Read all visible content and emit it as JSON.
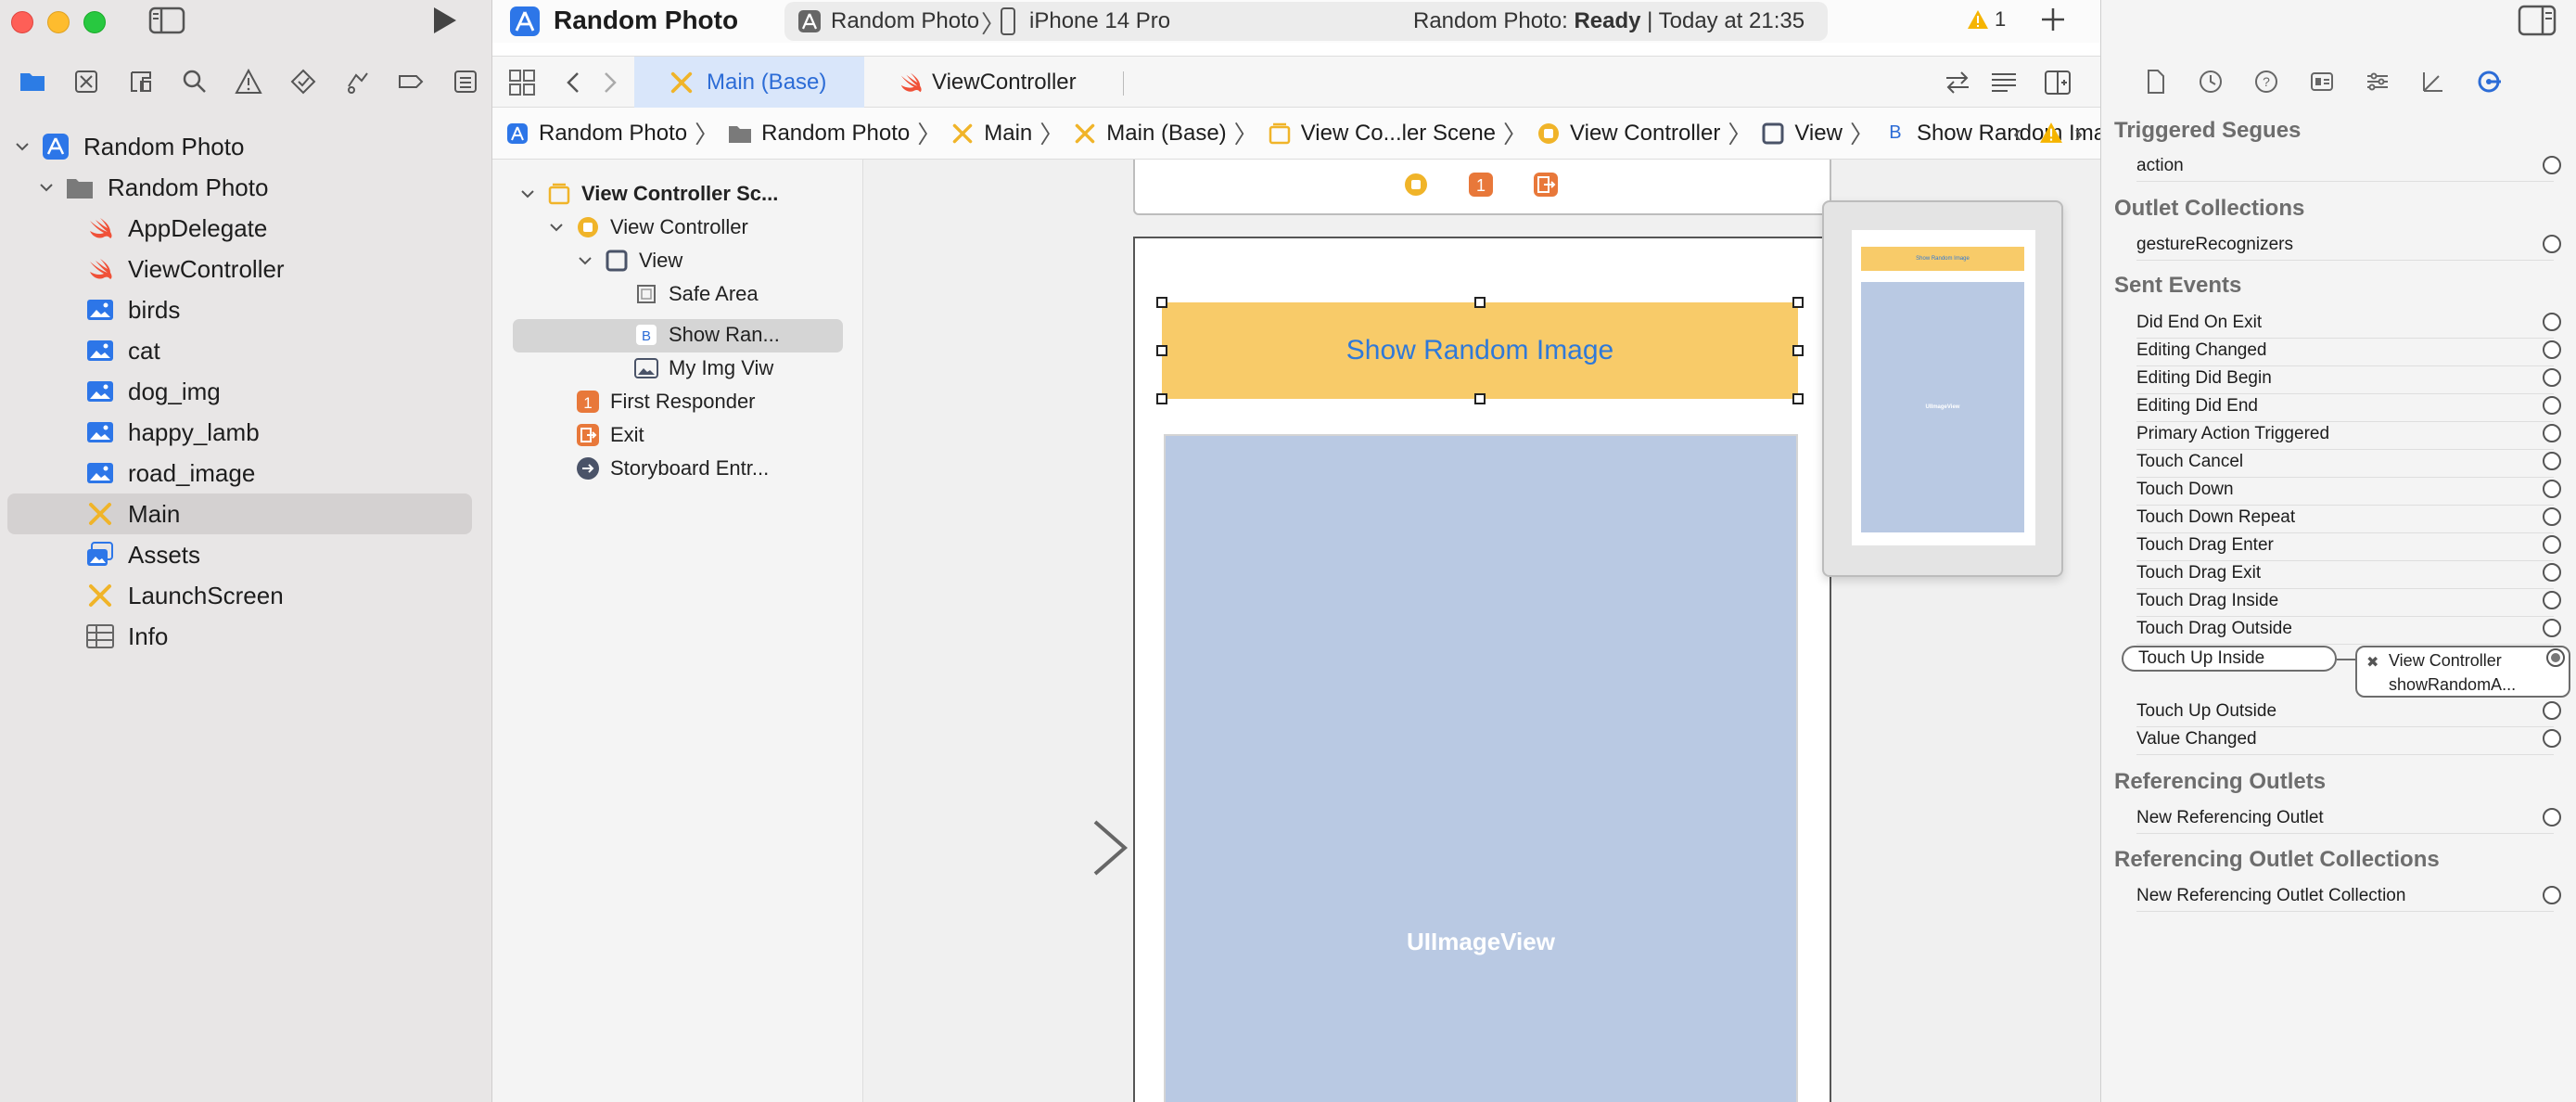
{
  "colors": {
    "accent": "#2c6cd6",
    "swift_orange": "#f05138",
    "storyboard_yellow": "#f0b429",
    "button_fill": "#f8cb69",
    "imageview_fill": "#b9c9e3"
  },
  "navigator": {
    "tabs": [
      "folder-icon",
      "source-control-icon",
      "symbol-icon",
      "find-icon",
      "issue-icon",
      "test-icon",
      "debug-icon",
      "breakpoint-icon",
      "report-icon"
    ],
    "items": [
      {
        "label": "Random Photo",
        "icon": "project-icon",
        "depth": 0,
        "expanded": true
      },
      {
        "label": "Random Photo",
        "icon": "folder-icon",
        "depth": 1,
        "expanded": true
      },
      {
        "label": "AppDelegate",
        "icon": "swift-icon",
        "depth": 2
      },
      {
        "label": "ViewController",
        "icon": "swift-icon",
        "depth": 2
      },
      {
        "label": "birds",
        "icon": "image-icon",
        "depth": 2
      },
      {
        "label": "cat",
        "icon": "image-icon",
        "depth": 2
      },
      {
        "label": "dog_img",
        "icon": "image-icon",
        "depth": 2
      },
      {
        "label": "happy_lamb",
        "icon": "image-icon",
        "depth": 2
      },
      {
        "label": "road_image",
        "icon": "image-icon",
        "depth": 2
      },
      {
        "label": "Main",
        "icon": "storyboard-icon",
        "depth": 2,
        "selected": true
      },
      {
        "label": "Assets",
        "icon": "assets-icon",
        "depth": 2
      },
      {
        "label": "LaunchScreen",
        "icon": "storyboard-icon",
        "depth": 2
      },
      {
        "label": "Info",
        "icon": "plist-icon",
        "depth": 2
      }
    ]
  },
  "toolbar": {
    "project_title": "Random Photo",
    "scheme": "Random Photo",
    "device": "iPhone 14 Pro",
    "status_prefix": "Random Photo: ",
    "status_state": "Ready",
    "status_suffix": " | Today at 21:35",
    "warning_count": "1"
  },
  "tabs": [
    {
      "label": "Main (Base)",
      "active": true,
      "icon": "storyboard-icon"
    },
    {
      "label": "ViewController",
      "active": false,
      "icon": "swift-icon"
    }
  ],
  "jumpbar": [
    {
      "label": "Random Photo",
      "icon": "project-icon"
    },
    {
      "label": "Random Photo",
      "icon": "folder-icon"
    },
    {
      "label": "Main",
      "icon": "storyboard-icon"
    },
    {
      "label": "Main (Base)",
      "icon": "storyboard-icon"
    },
    {
      "label": "View Co...ler Scene",
      "icon": "scene-icon"
    },
    {
      "label": "View Controller",
      "icon": "view-controller-icon"
    },
    {
      "label": "View",
      "icon": "view-icon"
    },
    {
      "label": "Show Random Image",
      "icon": "button-icon"
    }
  ],
  "outline": [
    {
      "label": "View Controller Sc...",
      "icon": "scene-icon",
      "bold": true
    },
    {
      "label": "View Controller",
      "icon": "view-controller-icon"
    },
    {
      "label": "View",
      "icon": "view-icon"
    },
    {
      "label": "Safe Area",
      "icon": "safe-area-icon"
    },
    {
      "label": "Show Ran...",
      "icon": "button-icon",
      "selected": true
    },
    {
      "label": "My Img Viw",
      "icon": "image-view-icon"
    },
    {
      "label": "First Responder",
      "icon": "first-responder-icon"
    },
    {
      "label": "Exit",
      "icon": "exit-icon"
    },
    {
      "label": "Storyboard Entr...",
      "icon": "entry-point-icon"
    }
  ],
  "canvas": {
    "button_title": "Show Random Image",
    "imageview_label": "UIImageView",
    "minimap_button": "Show Random Image",
    "minimap_image": "UIImageView"
  },
  "inspector": {
    "tabs": [
      "file-icon",
      "history-icon",
      "help-icon",
      "identity-icon",
      "attributes-icon",
      "size-icon",
      "connections-icon"
    ],
    "sections": [
      {
        "title": "Triggered Segues",
        "rows": [
          "action"
        ]
      },
      {
        "title": "Outlet Collections",
        "rows": [
          "gestureRecognizers"
        ]
      },
      {
        "title": "Sent Events",
        "rows": [
          "Did End On Exit",
          "Editing Changed",
          "Editing Did Begin",
          "Editing Did End",
          "Primary Action Triggered",
          "Touch Cancel",
          "Touch Down",
          "Touch Down Repeat",
          "Touch Drag Enter",
          "Touch Drag Exit",
          "Touch Drag Inside",
          "Touch Drag Outside",
          "Touch Up Inside",
          "Touch Up Outside",
          "Value Changed"
        ]
      },
      {
        "title": "Referencing Outlets",
        "rows": [
          "New Referencing Outlet"
        ]
      },
      {
        "title": "Referencing Outlet Collections",
        "rows": [
          "New Referencing Outlet Collection"
        ]
      }
    ],
    "connection": {
      "event": "Touch Up Inside",
      "target": "View Controller",
      "action": "showRandomA..."
    }
  }
}
